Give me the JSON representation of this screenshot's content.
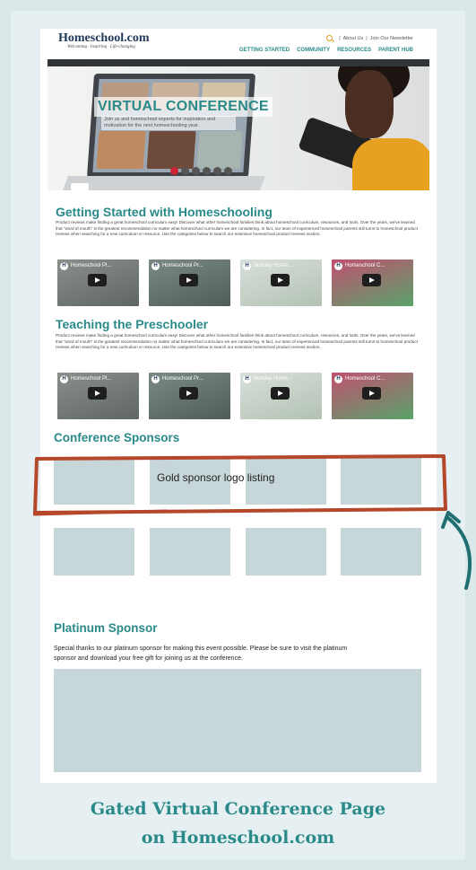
{
  "header": {
    "logo_text": "Homeschool.com",
    "tagline": "Welcoming · Inspiring · Life-changing",
    "top_links": [
      "About Us",
      "Join Our Newsletter"
    ],
    "nav": [
      "GETTING STARTED",
      "COMMUNITY",
      "RESOURCES",
      "PARENT HUB"
    ]
  },
  "hero": {
    "title": "VIRTUAL CONFERENCE",
    "subtitle": "Join us and homeschool experts for inspiration and motivation for the next homeschooling year."
  },
  "sections": [
    {
      "title": "Getting Started with Homeschooling",
      "text": "Product reviews make finding a great homeschool curriculum easy! Discover what other homeschool families think about homeschool curriculum, resources, and tools. Over the years, we've learned that \"word of mouth\" is the greatest recommendation no matter what homeschool curriculum we are considering. In fact, our team of experienced homeschool parents still turns to homeschool product reviews when searching for a new curriculum or resource. Use the categories below to search our extensive homeschool product reviews section.",
      "videos": [
        "Homeschool Pl...",
        "Homeschool Pr...",
        "Sunday Home...",
        "Homeschool C..."
      ]
    },
    {
      "title": "Teaching the Preschooler",
      "text": "Product reviews make finding a great homeschool curriculum easy! Discover what other homeschool families think about homeschool curriculum, resources, and tools. Over the years, we've learned that \"word of mouth\" is the greatest recommendation no matter what homeschool curriculum we are considering. In fact, our team of experienced homeschool parents still turns to homeschool product reviews when searching for a new curriculum or resource. Use the categories below to search our extensive homeschool product reviews section.",
      "videos": [
        "Homeschool Pl...",
        "Homeschool Pr...",
        "Sunday Home...",
        "Homeschool C..."
      ]
    }
  ],
  "sponsors": {
    "title": "Conference Sponsors",
    "gold_label": "Gold sponsor logo listing"
  },
  "platinum": {
    "title": "Platinum Sponsor",
    "text": "Special thanks to our platinum sponsor for making this event possible. Please be sure to visit the platinum sponsor and download your free gift for joining us at the conference."
  },
  "caption": {
    "line1": "Gated Virtual Conference Page",
    "line2": "on Homeschool.com"
  },
  "colors": {
    "accent": "#2a8a8a",
    "annotation": "#b5472a",
    "placeholder": "#c7d6d9"
  }
}
